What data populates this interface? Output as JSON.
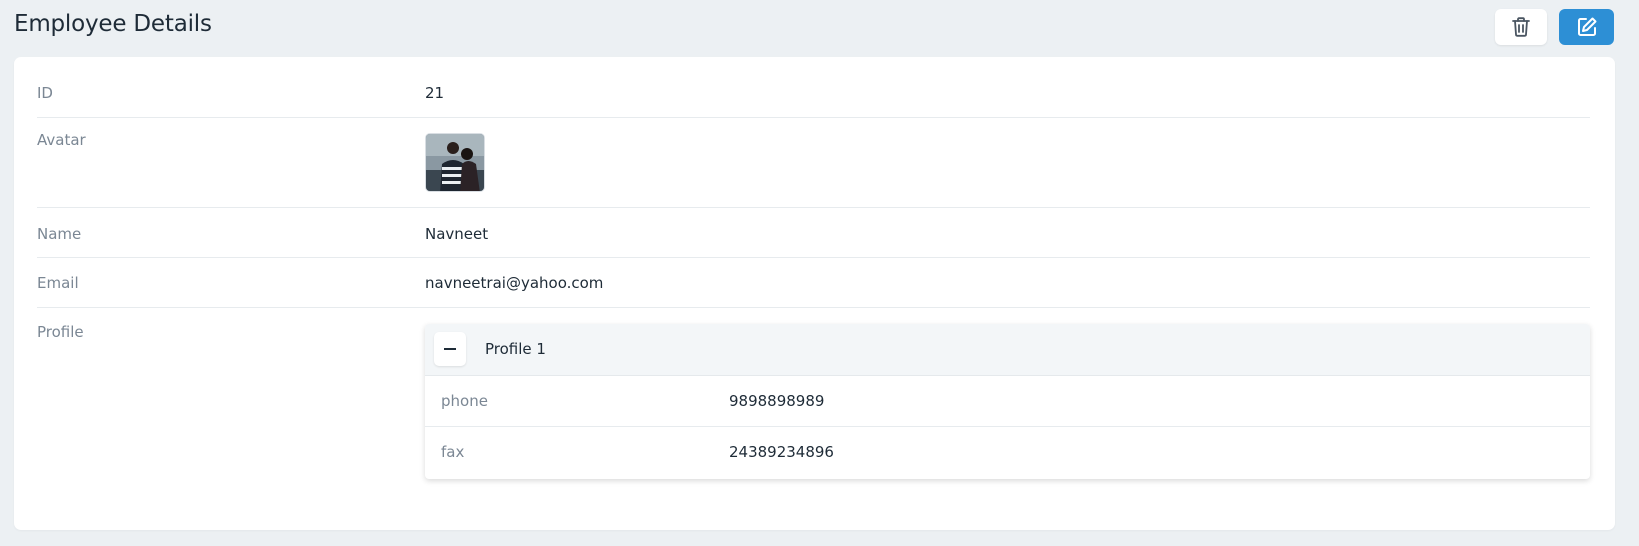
{
  "header": {
    "title": "Employee Details",
    "delete_icon": "trash-icon",
    "edit_icon": "edit-icon",
    "edit_color": "#2d8fd5"
  },
  "details": {
    "id": {
      "label": "ID",
      "value": "21"
    },
    "avatar": {
      "label": "Avatar"
    },
    "name": {
      "label": "Name",
      "value": "Navneet"
    },
    "email": {
      "label": "Email",
      "value": "navneetrai@yahoo.com"
    },
    "profile": {
      "label": "Profile",
      "items": [
        {
          "title": "Profile 1",
          "fields": [
            {
              "label": "phone",
              "value": "9898898989"
            },
            {
              "label": "fax",
              "value": "24389234896"
            }
          ]
        }
      ]
    }
  }
}
